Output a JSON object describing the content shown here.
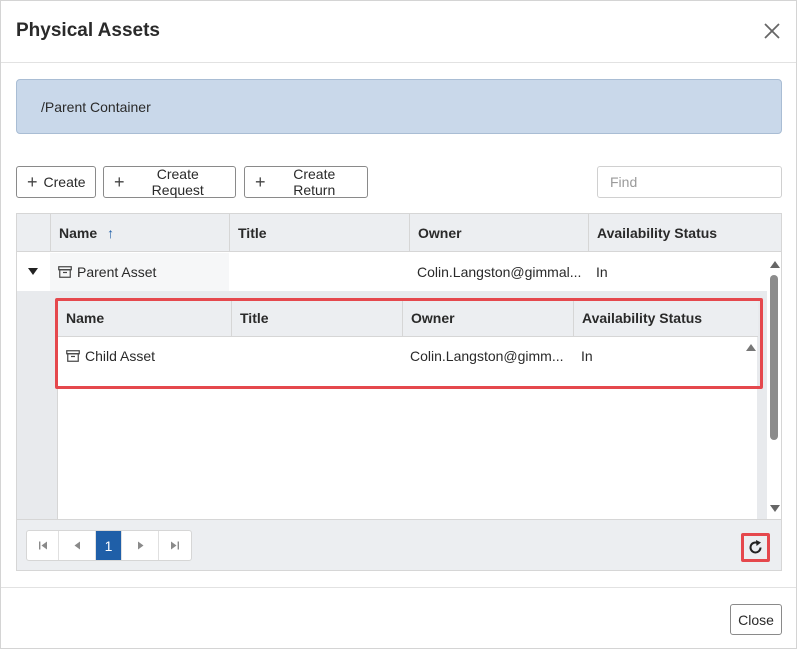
{
  "dialog": {
    "title": "Physical Assets",
    "close_icon": "close-icon"
  },
  "path": "/Parent Container",
  "toolbar": {
    "create_label": "Create",
    "create_request_label": "Create Request",
    "create_return_label": "Create Return",
    "plus_icon": "plus-icon",
    "find_placeholder": "Find"
  },
  "grid": {
    "columns": [
      "Name",
      "Title",
      "Owner",
      "Availability Status"
    ],
    "sort_icon": "sort-ascending-icon",
    "rows": [
      {
        "name": "Parent Asset",
        "title": "",
        "owner": "Colin.Langston@gimmal...",
        "status": "In",
        "icon": "archive-box-icon"
      }
    ],
    "child_grid": {
      "columns": [
        "Name",
        "Title",
        "Owner",
        "Availability Status"
      ],
      "rows": [
        {
          "name": "Child Asset",
          "title": "",
          "owner": "Colin.Langston@gimm...",
          "status": "In",
          "icon": "archive-box-icon"
        }
      ]
    }
  },
  "pager": {
    "current_page": "1",
    "first_icon": "first-page-icon",
    "prev_icon": "prev-page-icon",
    "next_icon": "next-page-icon",
    "last_icon": "last-page-icon",
    "refresh_icon": "refresh-icon"
  },
  "footer": {
    "close_label": "Close"
  },
  "colors": {
    "accent": "#1f5fa8",
    "highlight": "#e5484d",
    "path_bar": "#c9d8ea"
  }
}
